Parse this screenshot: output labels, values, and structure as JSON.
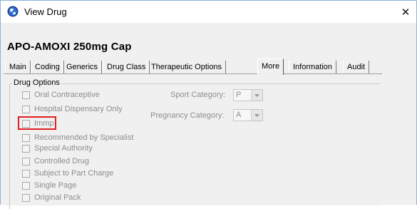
{
  "window": {
    "title": "View Drug",
    "close_glyph": "✕"
  },
  "drug": {
    "name": "APO-AMOXI 250mg Cap"
  },
  "tabs": [
    {
      "label": "Main"
    },
    {
      "label": "Coding"
    },
    {
      "label": "Generics"
    },
    {
      "label": "Drug Class"
    },
    {
      "label": "Therapeutic Options"
    },
    {
      "label": "More",
      "active": true
    },
    {
      "label": "Information"
    },
    {
      "label": "Audit"
    }
  ],
  "drug_options": {
    "group_label": "Drug Options",
    "options": [
      {
        "label": "Oral Contraceptive",
        "checked": false
      },
      {
        "label": "Hospital Dispensary Only",
        "checked": false
      },
      {
        "label": "Immp",
        "checked": false
      },
      {
        "label": "Recommended by Specialist",
        "checked": false
      },
      {
        "label": "Special Authority",
        "checked": false
      },
      {
        "label": "Controlled Drug",
        "checked": false
      },
      {
        "label": "Subject to Part Charge",
        "checked": false
      },
      {
        "label": "Single Page",
        "checked": false
      },
      {
        "label": "Original Pack",
        "checked": false
      }
    ],
    "sport_category": {
      "label": "Sport Category:",
      "value": "P"
    },
    "pregnancy_category": {
      "label": "Pregnancy Category:",
      "value": "A"
    }
  },
  "colors": {
    "highlight": "#e02020",
    "disabled_text": "#8d8d8d"
  }
}
